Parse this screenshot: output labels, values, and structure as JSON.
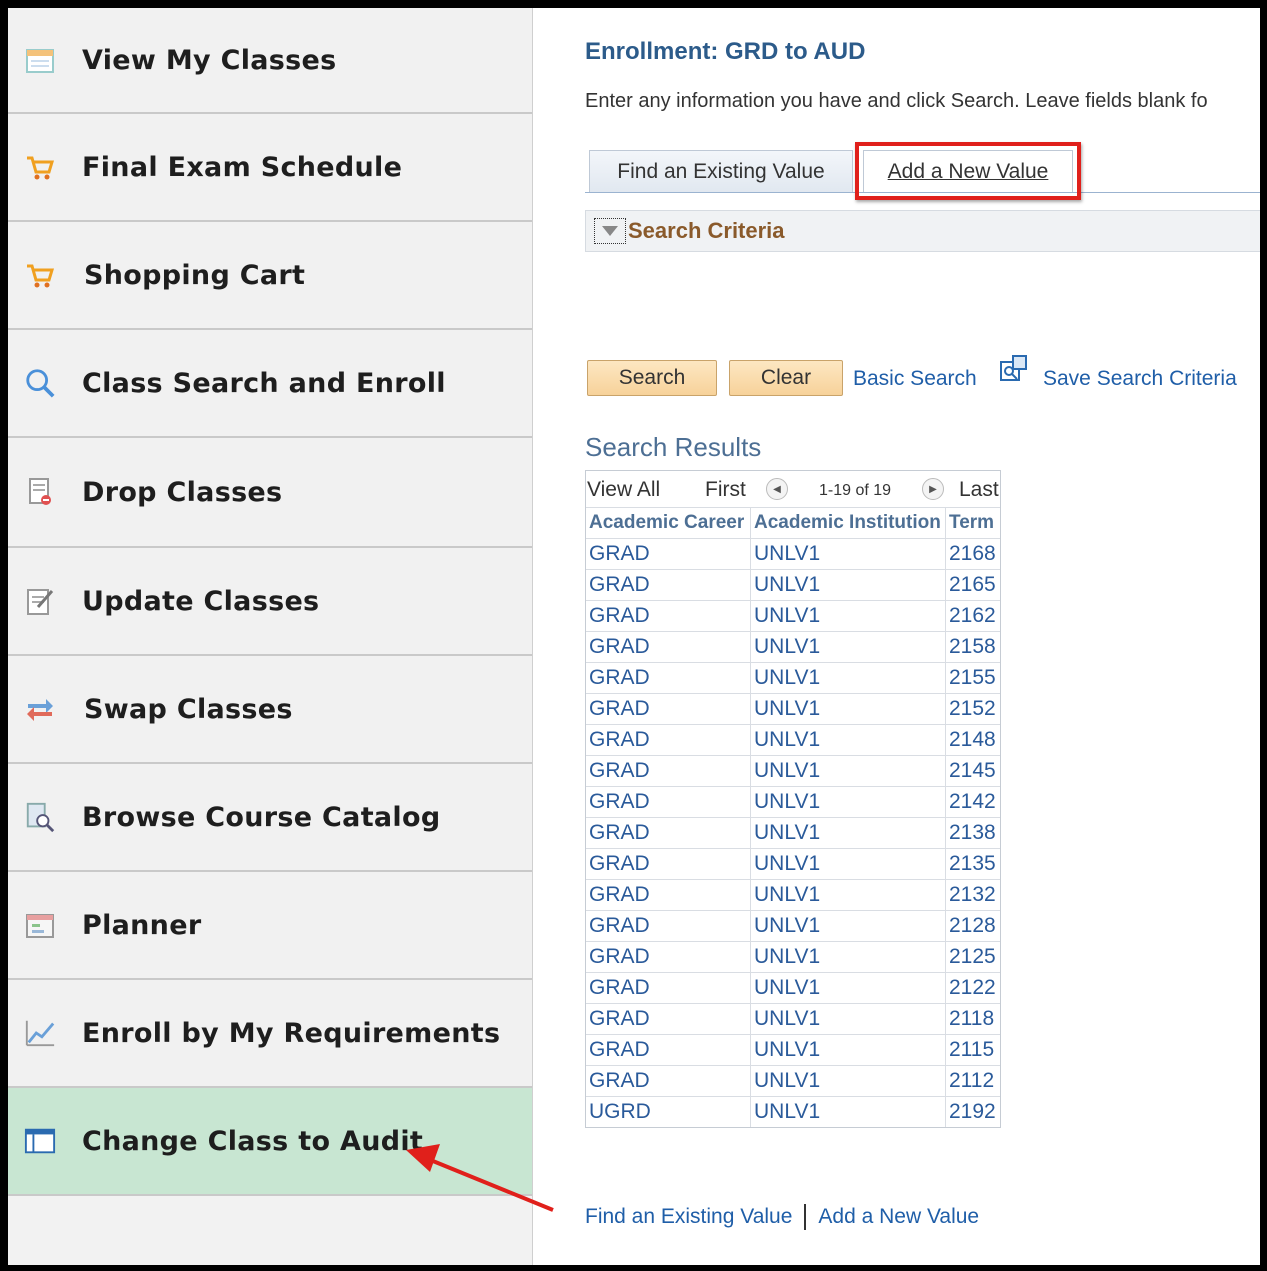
{
  "sidebar": {
    "items": [
      {
        "label": "View My Classes",
        "icon": "calendar-icon"
      },
      {
        "label": "Final Exam Schedule",
        "icon": "shopping-cart-icon"
      },
      {
        "label": "Shopping Cart",
        "icon": "shopping-cart-icon"
      },
      {
        "label": "Class Search and Enroll",
        "icon": "search-icon"
      },
      {
        "label": "Drop Classes",
        "icon": "drop-document-icon"
      },
      {
        "label": "Update Classes",
        "icon": "edit-document-icon"
      },
      {
        "label": "Swap Classes",
        "icon": "swap-arrows-icon"
      },
      {
        "label": "Browse Course Catalog",
        "icon": "catalog-search-icon"
      },
      {
        "label": "Planner",
        "icon": "planner-icon"
      },
      {
        "label": "Enroll by My Requirements",
        "icon": "line-chart-icon"
      },
      {
        "label": "Change Class to Audit",
        "icon": "window-icon",
        "active": true
      }
    ]
  },
  "main": {
    "title": "Enrollment: GRD to AUD",
    "instructions": "Enter any information you have and click Search. Leave fields blank fo",
    "tabs": {
      "find": "Find an Existing Value",
      "add": "Add a New Value"
    },
    "search_criteria": "Search Criteria",
    "buttons": {
      "search": "Search",
      "clear": "Clear"
    },
    "links": {
      "basic_search": "Basic Search",
      "save_criteria": "Save Search Criteria"
    },
    "results_title": "Search Results",
    "grid_nav": {
      "view_all": "View All",
      "first": "First",
      "range": "1-19 of 19",
      "last": "Last"
    },
    "columns": [
      "Academic Career",
      "Academic Institution",
      "Term"
    ],
    "rows": [
      [
        "GRAD",
        "UNLV1",
        "2168"
      ],
      [
        "GRAD",
        "UNLV1",
        "2165"
      ],
      [
        "GRAD",
        "UNLV1",
        "2162"
      ],
      [
        "GRAD",
        "UNLV1",
        "2158"
      ],
      [
        "GRAD",
        "UNLV1",
        "2155"
      ],
      [
        "GRAD",
        "UNLV1",
        "2152"
      ],
      [
        "GRAD",
        "UNLV1",
        "2148"
      ],
      [
        "GRAD",
        "UNLV1",
        "2145"
      ],
      [
        "GRAD",
        "UNLV1",
        "2142"
      ],
      [
        "GRAD",
        "UNLV1",
        "2138"
      ],
      [
        "GRAD",
        "UNLV1",
        "2135"
      ],
      [
        "GRAD",
        "UNLV1",
        "2132"
      ],
      [
        "GRAD",
        "UNLV1",
        "2128"
      ],
      [
        "GRAD",
        "UNLV1",
        "2125"
      ],
      [
        "GRAD",
        "UNLV1",
        "2122"
      ],
      [
        "GRAD",
        "UNLV1",
        "2118"
      ],
      [
        "GRAD",
        "UNLV1",
        "2115"
      ],
      [
        "GRAD",
        "UNLV1",
        "2112"
      ],
      [
        "UGRD",
        "UNLV1",
        "2192"
      ]
    ],
    "bottom_links": {
      "find": "Find an Existing Value",
      "add": "Add a New Value"
    }
  },
  "colors": {
    "highlight": "#e0201b",
    "active_nav": "#c8e6d2",
    "link": "#1f5ea8"
  }
}
